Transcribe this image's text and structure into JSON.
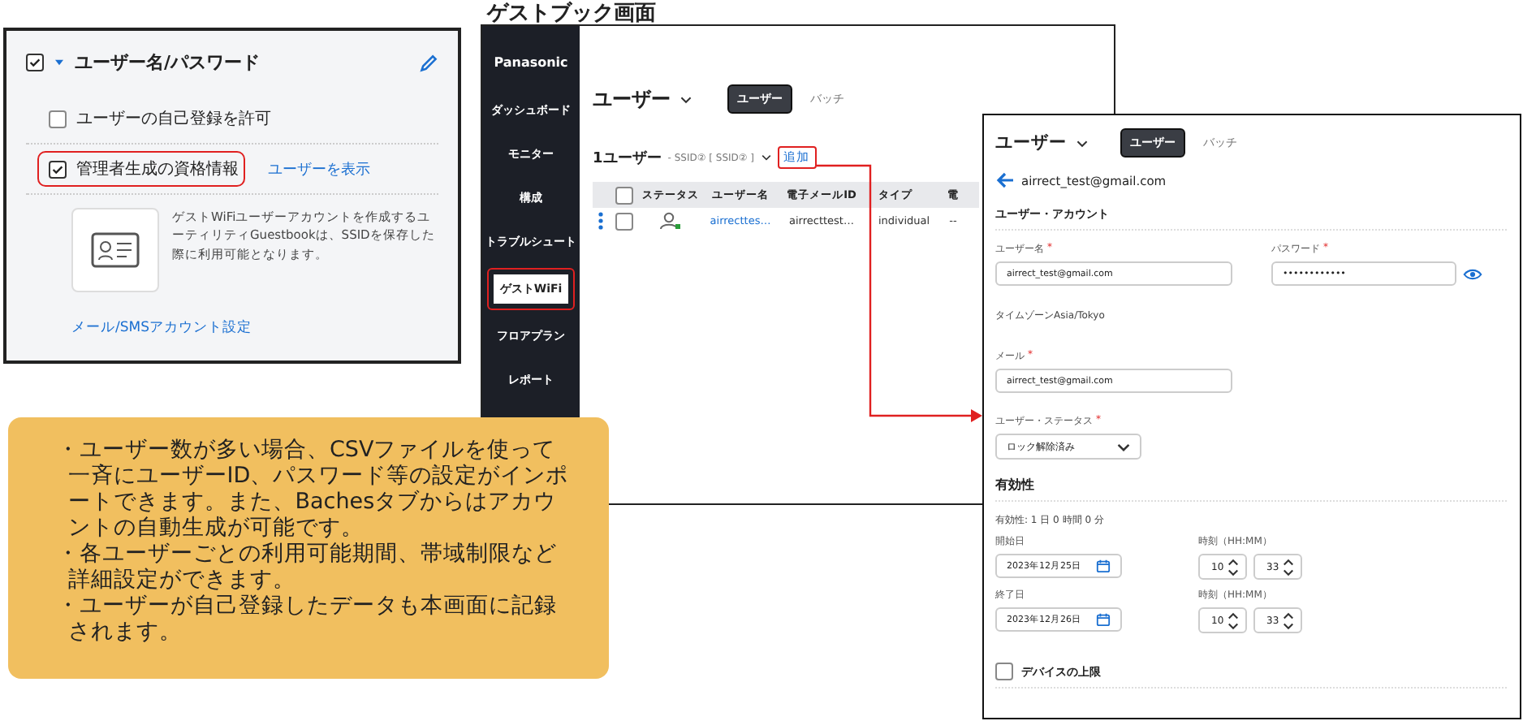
{
  "settings_panel": {
    "title_checked": true,
    "title": "ユーザー名/パスワード",
    "options": [
      {
        "label": "ユーザーの自己登録を許可",
        "checked": false,
        "highlighted": false
      },
      {
        "label": "管理者生成の資格情報",
        "checked": true,
        "highlighted": true,
        "link": "ユーザーを表示"
      }
    ],
    "description": "ゲストWiFiユーザーアカウントを作成するユーティリティGuestbookは、SSIDを保存した際に利用可能となります。",
    "footer_link": "メール/SMSアカウント設定"
  },
  "caption": "ゲストブック画面",
  "app": {
    "brand": "Panasonic",
    "nav": [
      {
        "label": "ダッシュボード",
        "selected": false,
        "highlighted": false
      },
      {
        "label": "モニター",
        "selected": false,
        "highlighted": false
      },
      {
        "label": "構成",
        "selected": false,
        "highlighted": false
      },
      {
        "label": "トラブルシュート",
        "selected": false,
        "highlighted": false
      },
      {
        "label": "ゲストWiFi",
        "selected": true,
        "highlighted": true
      },
      {
        "label": "フロアプラン",
        "selected": false,
        "highlighted": false
      },
      {
        "label": "レポート",
        "selected": false,
        "highlighted": false
      }
    ],
    "page_title": "ユーザー",
    "tabs": [
      {
        "label": "ユーザー",
        "selected": true
      },
      {
        "label": "バッチ",
        "selected": false
      }
    ],
    "count": "1ユーザー",
    "filter": "- SSID② [ SSID② ]",
    "add_link": {
      "label": "追加",
      "highlighted": true
    },
    "table": {
      "columns": [
        "ステータス",
        "ユーザー名",
        "電子メールID",
        "タイプ",
        "電"
      ],
      "all_selected": false,
      "rows": [
        {
          "selected": false,
          "cells": [
            "",
            "airrecttes…",
            "airrecttest…",
            "individual",
            "--"
          ]
        }
      ]
    }
  },
  "user_detail": {
    "page_title": "ユーザー",
    "tabs": [
      {
        "label": "ユーザー",
        "selected": true
      },
      {
        "label": "バッチ",
        "selected": false
      }
    ],
    "email": "airrect_test@gmail.com",
    "account_heading": "ユーザー・アカウント",
    "username": {
      "label": "ユーザー名",
      "required_mark": "*",
      "value": "airrect_test@gmail.com"
    },
    "password": {
      "label": "パスワード",
      "required_mark": "*",
      "value": "••••••••••••"
    },
    "timezone": "タイムゾーンAsia/Tokyo",
    "mail": {
      "label": "メール",
      "required_mark": "*",
      "value": "airrect_test@gmail.com"
    },
    "status": {
      "label": "ユーザー・ステータス",
      "required_mark": "*",
      "value": "ロック解除済み"
    },
    "validity_heading": "有効性",
    "validity_summary": "有効性: 1 日 0 時間 0 分",
    "periods": [
      {
        "date_label": "開始日",
        "date": "2023年12月25日",
        "time_label": "時刻（HH:MM）",
        "hour": "10",
        "minute": "33"
      },
      {
        "date_label": "終了日",
        "date": "2023年12月26日",
        "time_label": "時刻（HH:MM）",
        "hour": "10",
        "minute": "33"
      }
    ],
    "device_limit": {
      "label": "デバイスの上限",
      "checked": false
    }
  },
  "note": [
    "・ユーザー数が多い場合、CSVファイルを使って一斉にユーザーID、パスワード等の設定がインポートできます。また、Bachesタブからはアカウントの自動生成が可能です。",
    "・各ユーザーごとの利用可能期間、帯域制限など詳細設定ができます。",
    "・ユーザーが自己登録したデータも本画面に記録されます。"
  ]
}
